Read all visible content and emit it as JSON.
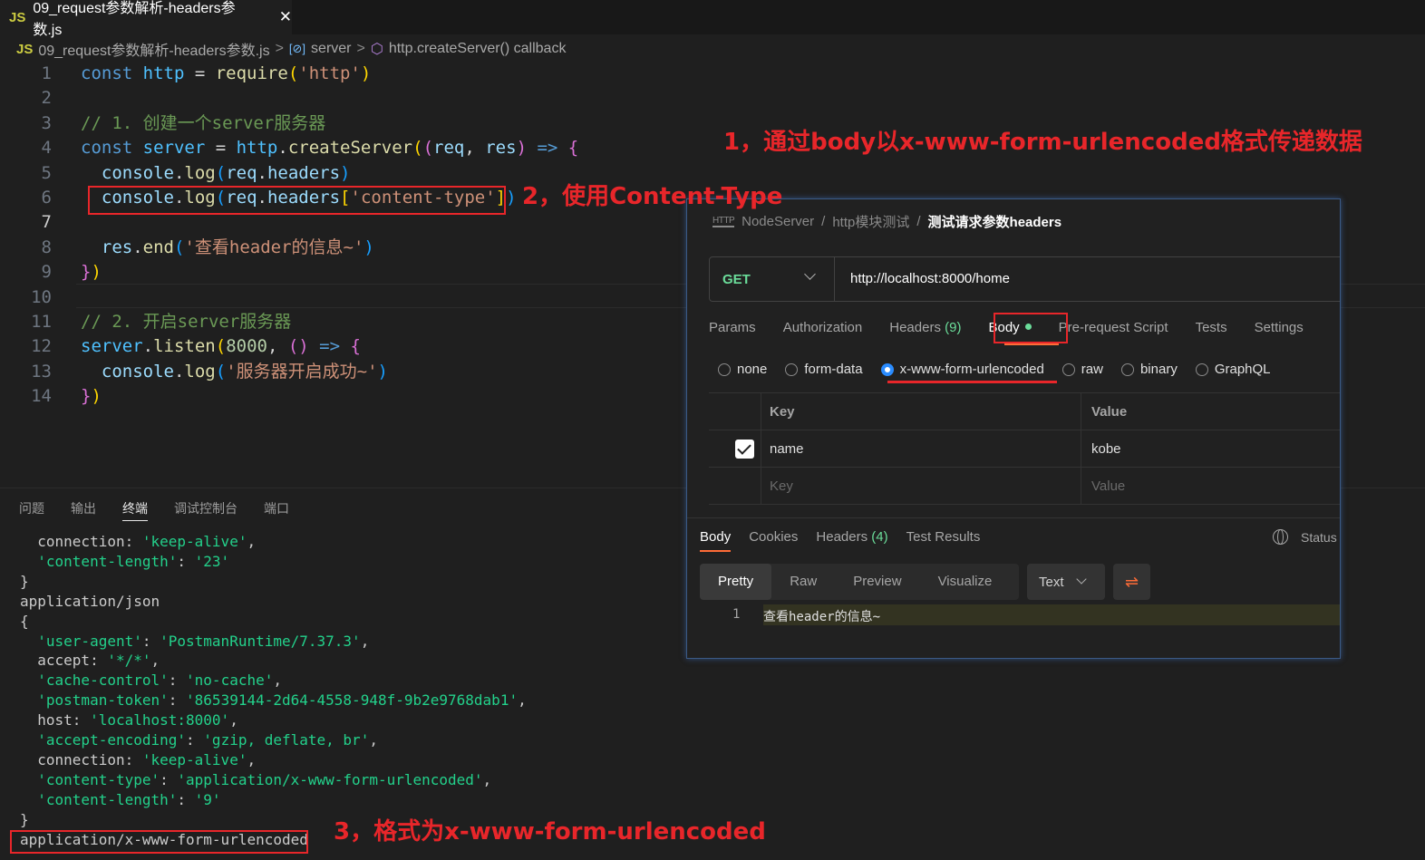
{
  "tab": {
    "lang_badge": "JS",
    "title": "09_request参数解析-headers参数.js",
    "close": "✕"
  },
  "breadcrumb": {
    "lang_badge": "JS",
    "file": "09_request参数解析-headers参数.js",
    "sep": ">",
    "scope_icon": "[⊘]",
    "scope": "server",
    "fn_icon": "⬡",
    "fn": "http.createServer() callback"
  },
  "editor": {
    "line_numbers": [
      "1",
      "2",
      "3",
      "4",
      "5",
      "6",
      "7",
      "8",
      "9",
      "10",
      "11",
      "12",
      "13",
      "14"
    ],
    "active_line": "7",
    "lines": [
      [
        {
          "t": "const ",
          "c": "kw"
        },
        {
          "t": "http",
          "c": "var"
        },
        {
          "t": " = ",
          "c": "plain"
        },
        {
          "t": "require",
          "c": "fn"
        },
        {
          "t": "(",
          "c": "br1"
        },
        {
          "t": "'http'",
          "c": "str"
        },
        {
          "t": ")",
          "c": "br1"
        }
      ],
      [],
      [
        {
          "t": "// 1. 创建一个server服务器",
          "c": "cmt"
        }
      ],
      [
        {
          "t": "const ",
          "c": "kw"
        },
        {
          "t": "server",
          "c": "var"
        },
        {
          "t": " = ",
          "c": "plain"
        },
        {
          "t": "http",
          "c": "var"
        },
        {
          "t": ".",
          "c": "plain"
        },
        {
          "t": "createServer",
          "c": "fn"
        },
        {
          "t": "(",
          "c": "br1"
        },
        {
          "t": "(",
          "c": "br2"
        },
        {
          "t": "req",
          "c": "prop"
        },
        {
          "t": ", ",
          "c": "plain"
        },
        {
          "t": "res",
          "c": "prop"
        },
        {
          "t": ")",
          "c": "br2"
        },
        {
          "t": " => ",
          "c": "kw"
        },
        {
          "t": "{",
          "c": "br2"
        }
      ],
      [
        {
          "t": "  console",
          "c": "prop"
        },
        {
          "t": ".",
          "c": "plain"
        },
        {
          "t": "log",
          "c": "fn"
        },
        {
          "t": "(",
          "c": "br3"
        },
        {
          "t": "req",
          "c": "prop"
        },
        {
          "t": ".",
          "c": "plain"
        },
        {
          "t": "headers",
          "c": "prop"
        },
        {
          "t": ")",
          "c": "br3"
        }
      ],
      [
        {
          "t": "  console",
          "c": "prop"
        },
        {
          "t": ".",
          "c": "plain"
        },
        {
          "t": "log",
          "c": "fn"
        },
        {
          "t": "(",
          "c": "br3"
        },
        {
          "t": "req",
          "c": "prop"
        },
        {
          "t": ".",
          "c": "plain"
        },
        {
          "t": "headers",
          "c": "prop"
        },
        {
          "t": "[",
          "c": "br1"
        },
        {
          "t": "'content-type'",
          "c": "str"
        },
        {
          "t": "]",
          "c": "br1"
        },
        {
          "t": ")",
          "c": "br3"
        }
      ],
      [],
      [
        {
          "t": "  res",
          "c": "prop"
        },
        {
          "t": ".",
          "c": "plain"
        },
        {
          "t": "end",
          "c": "fn"
        },
        {
          "t": "(",
          "c": "br3"
        },
        {
          "t": "'查看header的信息~'",
          "c": "str"
        },
        {
          "t": ")",
          "c": "br3"
        }
      ],
      [
        {
          "t": "}",
          "c": "br2"
        },
        {
          "t": ")",
          "c": "br1"
        }
      ],
      [],
      [
        {
          "t": "// 2. 开启server服务器",
          "c": "cmt"
        }
      ],
      [
        {
          "t": "server",
          "c": "var"
        },
        {
          "t": ".",
          "c": "plain"
        },
        {
          "t": "listen",
          "c": "fn"
        },
        {
          "t": "(",
          "c": "br1"
        },
        {
          "t": "8000",
          "c": "num"
        },
        {
          "t": ", ",
          "c": "plain"
        },
        {
          "t": "()",
          "c": "br2"
        },
        {
          "t": " => ",
          "c": "kw"
        },
        {
          "t": "{",
          "c": "br2"
        }
      ],
      [
        {
          "t": "  console",
          "c": "prop"
        },
        {
          "t": ".",
          "c": "plain"
        },
        {
          "t": "log",
          "c": "fn"
        },
        {
          "t": "(",
          "c": "br3"
        },
        {
          "t": "'服务器开启成功~'",
          "c": "str"
        },
        {
          "t": ")",
          "c": "br3"
        }
      ],
      [
        {
          "t": "}",
          "c": "br2"
        },
        {
          "t": ")",
          "c": "br1"
        }
      ]
    ]
  },
  "panel": {
    "tabs": [
      "问题",
      "输出",
      "终端",
      "调试控制台",
      "端口"
    ],
    "active_tab": "终端"
  },
  "terminal": {
    "lines": [
      [
        {
          "t": "  connection: "
        },
        {
          "t": "'keep-alive'",
          "s": 1
        },
        {
          "t": ","
        }
      ],
      [
        {
          "t": "  "
        },
        {
          "t": "'content-length'",
          "s": 1
        },
        {
          "t": ": "
        },
        {
          "t": "'23'",
          "s": 1
        }
      ],
      [
        {
          "t": "}"
        }
      ],
      [
        {
          "t": "application/json"
        }
      ],
      [
        {
          "t": "{"
        }
      ],
      [
        {
          "t": "  "
        },
        {
          "t": "'user-agent'",
          "s": 1
        },
        {
          "t": ": "
        },
        {
          "t": "'PostmanRuntime/7.37.3'",
          "s": 1
        },
        {
          "t": ","
        }
      ],
      [
        {
          "t": "  accept: "
        },
        {
          "t": "'*/*'",
          "s": 1
        },
        {
          "t": ","
        }
      ],
      [
        {
          "t": "  "
        },
        {
          "t": "'cache-control'",
          "s": 1
        },
        {
          "t": ": "
        },
        {
          "t": "'no-cache'",
          "s": 1
        },
        {
          "t": ","
        }
      ],
      [
        {
          "t": "  "
        },
        {
          "t": "'postman-token'",
          "s": 1
        },
        {
          "t": ": "
        },
        {
          "t": "'86539144-2d64-4558-948f-9b2e9768dab1'",
          "s": 1
        },
        {
          "t": ","
        }
      ],
      [
        {
          "t": "  host: "
        },
        {
          "t": "'localhost:8000'",
          "s": 1
        },
        {
          "t": ","
        }
      ],
      [
        {
          "t": "  "
        },
        {
          "t": "'accept-encoding'",
          "s": 1
        },
        {
          "t": ": "
        },
        {
          "t": "'gzip, deflate, br'",
          "s": 1
        },
        {
          "t": ","
        }
      ],
      [
        {
          "t": "  connection: "
        },
        {
          "t": "'keep-alive'",
          "s": 1
        },
        {
          "t": ","
        }
      ],
      [
        {
          "t": "  "
        },
        {
          "t": "'content-type'",
          "s": 1
        },
        {
          "t": ": "
        },
        {
          "t": "'application/x-www-form-urlencoded'",
          "s": 1
        },
        {
          "t": ","
        }
      ],
      [
        {
          "t": "  "
        },
        {
          "t": "'content-length'",
          "s": 1
        },
        {
          "t": ": "
        },
        {
          "t": "'9'",
          "s": 1
        }
      ],
      [
        {
          "t": "}"
        }
      ],
      [
        {
          "t": "application/x-www-form-urlencoded"
        }
      ]
    ]
  },
  "postman": {
    "breadcrumb": {
      "icon": "HTTP",
      "items": [
        "NodeServer",
        "http模块测试"
      ],
      "sep": "/",
      "current": "测试请求参数headers"
    },
    "method": "GET",
    "url": "http://localhost:8000/home",
    "req_tabs": {
      "params": "Params",
      "authorization": "Authorization",
      "headers": "Headers",
      "headers_count": "(9)",
      "body": "Body",
      "pre_request": "Pre-request Script",
      "tests": "Tests",
      "settings": "Settings"
    },
    "body_types": [
      "none",
      "form-data",
      "x-www-form-urlencoded",
      "raw",
      "binary",
      "GraphQL"
    ],
    "selected_body_type": "x-www-form-urlencoded",
    "kv": {
      "key_header": "Key",
      "value_header": "Value",
      "row_key": "name",
      "row_value": "kobe",
      "key_placeholder": "Key",
      "value_placeholder": "Value"
    },
    "resp_tabs": {
      "body": "Body",
      "cookies": "Cookies",
      "headers": "Headers",
      "headers_count": "(4)",
      "test_results": "Test Results",
      "status": "Status"
    },
    "view_tabs": [
      "Pretty",
      "Raw",
      "Preview",
      "Visualize"
    ],
    "format": "Text",
    "response": {
      "line_no": "1",
      "text": "查看header的信息~"
    }
  },
  "annotations": {
    "a1": "1，通过body以x-www-form-urlencoded格式传递数据",
    "a2": "2，使用Content-Type",
    "a3": "3，格式为x-www-form-urlencoded"
  },
  "colors": {
    "annotation_red": "#e8262a",
    "postman_orange": "#ff6c37",
    "get_green": "#6bdd9a",
    "terminal_string": "#23d18b"
  }
}
